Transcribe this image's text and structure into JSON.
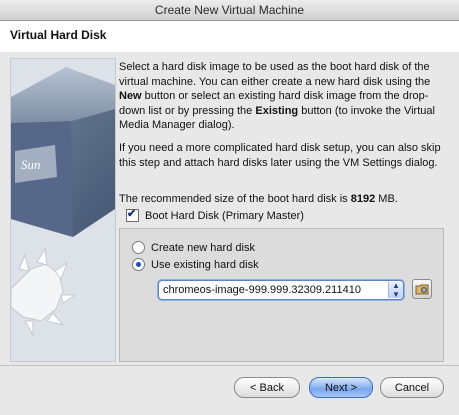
{
  "window": {
    "title": "Create New Virtual Machine"
  },
  "header": {
    "title": "Virtual Hard Disk"
  },
  "intro": {
    "p1_a": "Select a hard disk image to be used as the boot hard disk of the virtual machine. You can either create a new hard disk using the ",
    "p1_new": "New",
    "p1_b": " button or select an existing hard disk image from the drop-down list or by pressing the ",
    "p1_existing": "Existing",
    "p1_c": " button (to invoke the Virtual Media Manager dialog).",
    "p2": "If you need a more complicated hard disk setup, you can also skip this step and attach hard disks later using the VM Settings dialog.",
    "p3_a": "The recommended size of the boot hard disk is ",
    "p3_size": "8192",
    "p3_unit": " MB."
  },
  "boot_disk": {
    "label": "Boot Hard Disk (Primary Master)",
    "checked": true
  },
  "options": {
    "create_label": "Create new hard disk",
    "existing_label": "Use existing hard disk",
    "selected": "existing"
  },
  "combo": {
    "value": "chromeos-image-999.999.32309.211410"
  },
  "icons": {
    "sidebar": "virtualbox-sun-cube-icon",
    "combo_arrow": "updown-arrow-icon",
    "vmm": "folder-disk-icon"
  },
  "buttons": {
    "back": "< Back",
    "next": "Next >",
    "cancel": "Cancel"
  }
}
